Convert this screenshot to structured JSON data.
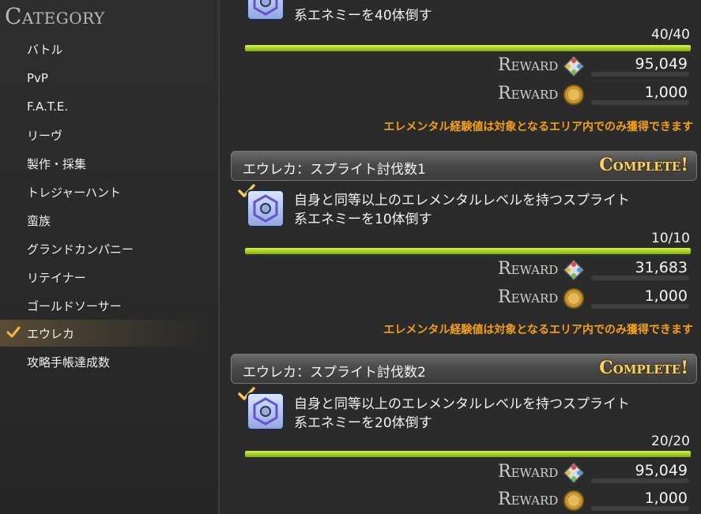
{
  "sidebar": {
    "title": "Category",
    "items": [
      {
        "label": "バトル"
      },
      {
        "label": "PvP"
      },
      {
        "label": "F.A.T.E."
      },
      {
        "label": "リーヴ"
      },
      {
        "label": "製作・採集"
      },
      {
        "label": "トレジャーハント"
      },
      {
        "label": "蛮族"
      },
      {
        "label": "グランドカンパニー"
      },
      {
        "label": "リテイナー"
      },
      {
        "label": "ゴールドソーサー"
      },
      {
        "label": "エウレカ"
      },
      {
        "label": "攻略手帳達成数"
      }
    ],
    "active_index": 10
  },
  "achievements": [
    {
      "partial": true,
      "desc_line2": "系エネミーを40体倒す",
      "progress": "40/40",
      "progress_ratio": 1.0,
      "rewards": [
        {
          "label": "Reward",
          "icon": "elemental-exp-icon",
          "value": "95,049"
        },
        {
          "label": "Reward",
          "icon": "gil-coin-icon",
          "value": "1,000"
        }
      ],
      "note": "エレメンタル経験値は対象となるエリア内でのみ獲得できます"
    },
    {
      "title": "エウレカ：スプライト討伐数1",
      "status": "Complete!",
      "desc_line1": "自身と同等以上のエレメンタルレベルを持つスプライト",
      "desc_line2": "系エネミーを10体倒す",
      "progress": "10/10",
      "progress_ratio": 1.0,
      "rewards": [
        {
          "label": "Reward",
          "icon": "elemental-exp-icon",
          "value": "31,683"
        },
        {
          "label": "Reward",
          "icon": "gil-coin-icon",
          "value": "1,000"
        }
      ],
      "note": "エレメンタル経験値は対象となるエリア内でのみ獲得できます"
    },
    {
      "title": "エウレカ：スプライト討伐数2",
      "status": "Complete!",
      "desc_line1": "自身と同等以上のエレメンタルレベルを持つスプライト",
      "desc_line2": "系エネミーを20体倒す",
      "progress": "20/20",
      "progress_ratio": 1.0,
      "rewards": [
        {
          "label": "Reward",
          "icon": "elemental-exp-icon",
          "value": "95,049"
        },
        {
          "label": "Reward",
          "icon": "gil-coin-icon",
          "value": "1,000"
        }
      ]
    }
  ],
  "colors": {
    "accent_orange": "#f2a01a",
    "progress_green": "#a8d421",
    "complete_gold": "#f3d27a"
  }
}
